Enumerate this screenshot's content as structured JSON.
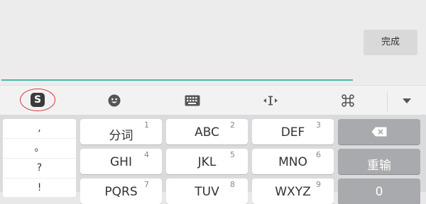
{
  "header": {
    "done_label": "完成"
  },
  "toolbar": {
    "items": [
      {
        "icon": "sogou-logo-icon",
        "logo_text": "S"
      },
      {
        "icon": "emoji-icon"
      },
      {
        "icon": "keyboard-icon"
      },
      {
        "icon": "cursor-move-icon"
      },
      {
        "icon": "command-icon"
      },
      {
        "icon": "collapse-arrow-icon"
      }
    ]
  },
  "keyboard": {
    "punctuation": [
      ",",
      "。",
      "?",
      "!"
    ],
    "rows": [
      [
        {
          "label": "分词",
          "num": "1"
        },
        {
          "label": "ABC",
          "num": "2"
        },
        {
          "label": "DEF",
          "num": "3"
        }
      ],
      [
        {
          "label": "GHI",
          "num": "4"
        },
        {
          "label": "JKL",
          "num": "5"
        },
        {
          "label": "MNO",
          "num": "6"
        }
      ],
      [
        {
          "label": "PQRS",
          "num": "7"
        },
        {
          "label": "TUV",
          "num": "8"
        },
        {
          "label": "WXYZ",
          "num": "9"
        }
      ]
    ],
    "side_keys": {
      "delete_icon": "backspace-icon",
      "retype_label": "重输",
      "zero_label": "0"
    }
  },
  "colors": {
    "accent_line": "#4db6ac",
    "logo_ring": "#d9383a",
    "function_key": "#a9aaad"
  }
}
